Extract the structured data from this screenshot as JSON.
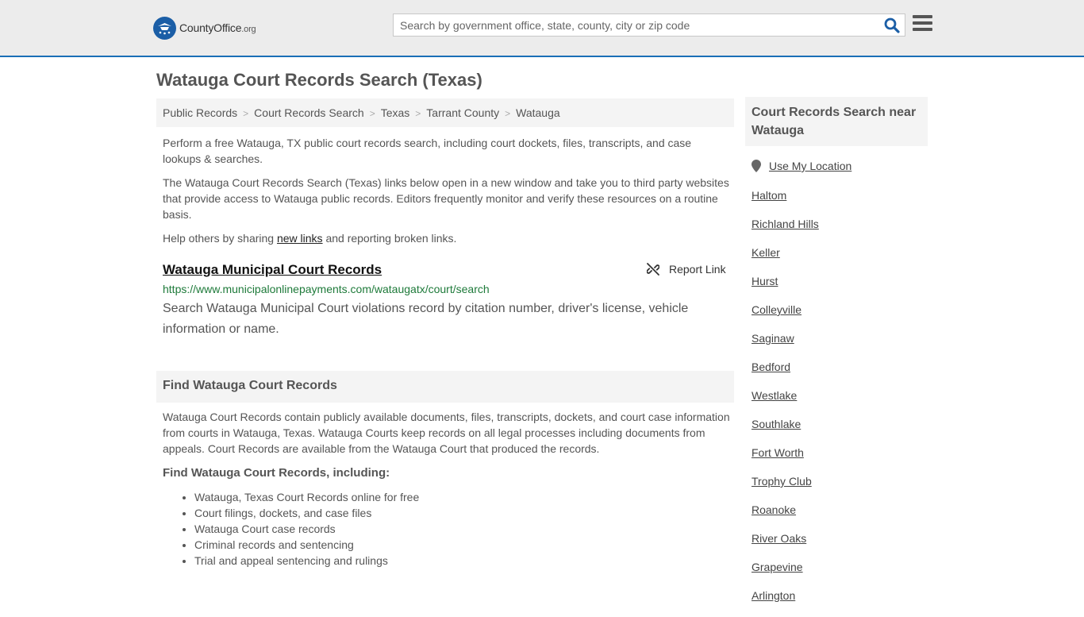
{
  "header": {
    "logo_county": "County",
    "logo_office": "Office",
    "logo_org": ".org",
    "search_placeholder": "Search by government office, state, county, city or zip code"
  },
  "page_title": "Watauga Court Records Search (Texas)",
  "breadcrumb": [
    "Public Records",
    "Court Records Search",
    "Texas",
    "Tarrant County",
    "Watauga"
  ],
  "intro": {
    "p1": "Perform a free Watauga, TX public court records search, including court dockets, files, transcripts, and case lookups & searches.",
    "p2": "The Watauga Court Records Search (Texas) links below open in a new window and take you to third party websites that provide access to Watauga public records. Editors frequently monitor and verify these resources on a routine basis.",
    "p3_before": "Help others by sharing ",
    "p3_link": "new links",
    "p3_after": " and reporting broken links."
  },
  "result": {
    "title": "Watauga Municipal Court Records",
    "report_label": "Report Link",
    "url": "https://www.municipalonlinepayments.com/wataugatx/court/search",
    "description": "Search Watauga Municipal Court violations record by citation number, driver's license, vehicle information or name."
  },
  "find_section": {
    "heading": "Find Watauga Court Records",
    "paragraph": "Watauga Court Records contain publicly available documents, files, transcripts, dockets, and court case information from courts in Watauga, Texas. Watauga Courts keep records on all legal processes including documents from appeals. Court Records are available from the Watauga Court that produced the records.",
    "subheading": "Find Watauga Court Records, including:",
    "items": [
      "Watauga, Texas Court Records online for free",
      "Court filings, dockets, and case files",
      "Watauga Court case records",
      "Criminal records and sentencing",
      "Trial and appeal sentencing and rulings"
    ]
  },
  "sidebar": {
    "heading": "Court Records Search near Watauga",
    "use_location": "Use My Location",
    "nearby": [
      "Haltom",
      "Richland Hills",
      "Keller",
      "Hurst",
      "Colleyville",
      "Saginaw",
      "Bedford",
      "Westlake",
      "Southlake",
      "Fort Worth",
      "Trophy Club",
      "Roanoke",
      "River Oaks",
      "Grapevine",
      "Arlington"
    ]
  }
}
